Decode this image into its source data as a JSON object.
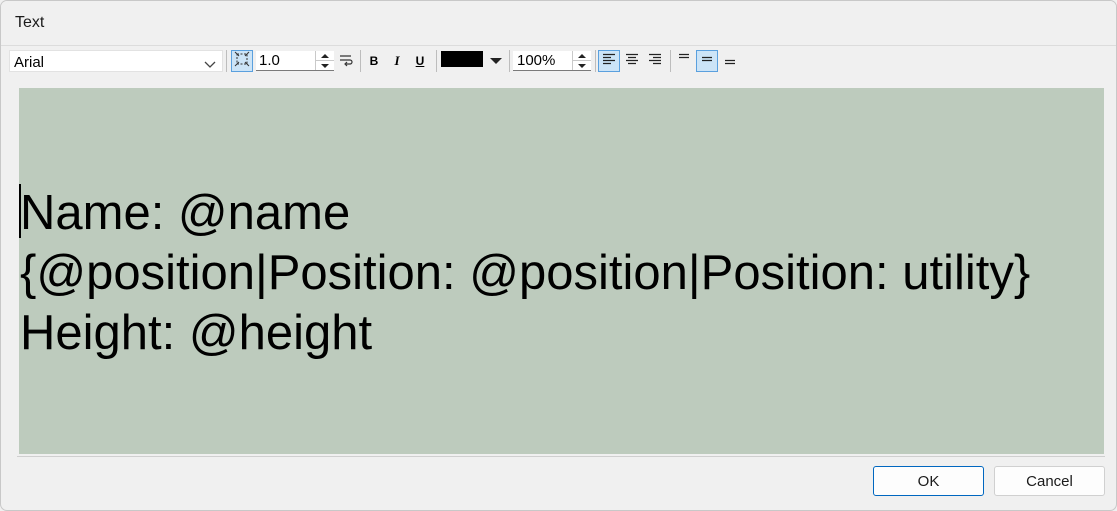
{
  "window": {
    "title": "Text"
  },
  "toolbar": {
    "font": "Arial",
    "line_spacing": "1.0",
    "text_color": "#000000",
    "zoom": "100%",
    "bold_label": "B",
    "italic_label": "I",
    "underline_label": "U"
  },
  "editor": {
    "background": "#bdcbbd",
    "text": "Name: @name\n{@position|Position: @position|Position: utility}\nHeight: @height"
  },
  "buttons": {
    "ok": "OK",
    "cancel": "Cancel"
  },
  "colors": {
    "accent": "#0067c0",
    "active_fill": "#cce4f7"
  }
}
